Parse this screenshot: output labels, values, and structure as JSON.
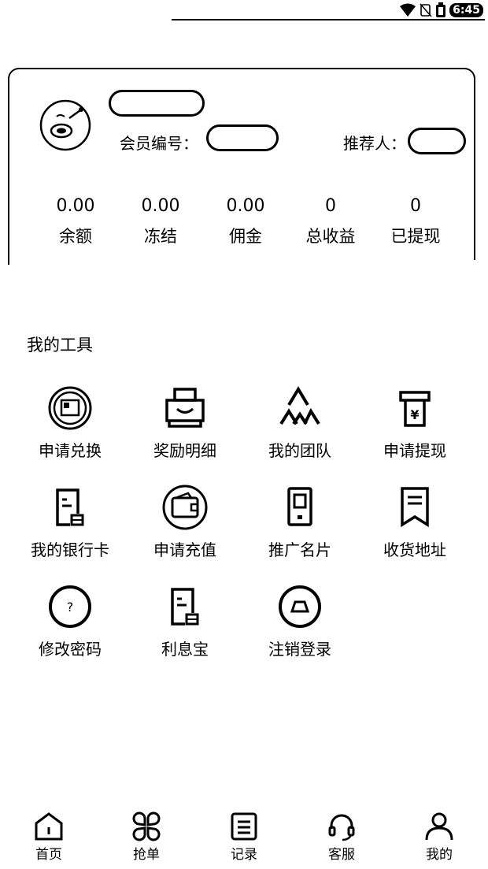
{
  "status_bar": {
    "time": "6:45"
  },
  "profile": {
    "member_no_label": "会员编号：",
    "referrer_label": "推荐人：",
    "stats": [
      {
        "value": "0.00",
        "label": "余额"
      },
      {
        "value": "0.00",
        "label": "冻结"
      },
      {
        "value": "0.00",
        "label": "佣金"
      },
      {
        "value": "0",
        "label": "总收益"
      },
      {
        "value": "0",
        "label": "已提现"
      }
    ]
  },
  "tools": {
    "title": "我的工具",
    "items": [
      {
        "label": "申请兑换",
        "icon": "exchange-icon"
      },
      {
        "label": "奖励明细",
        "icon": "printer-icon"
      },
      {
        "label": "我的团队",
        "icon": "team-icon"
      },
      {
        "label": "申请提现",
        "icon": "atm-icon"
      },
      {
        "label": "我的银行卡",
        "icon": "bank-doc-icon"
      },
      {
        "label": "申请充值",
        "icon": "wallet-icon"
      },
      {
        "label": "推广名片",
        "icon": "card-icon"
      },
      {
        "label": "收货地址",
        "icon": "bookmark-icon"
      },
      {
        "label": "修改密码",
        "icon": "question-icon"
      },
      {
        "label": "利息宝",
        "icon": "interest-doc-icon"
      },
      {
        "label": "注销登录",
        "icon": "logout-icon"
      }
    ]
  },
  "nav": {
    "items": [
      {
        "label": "首页",
        "icon": "home-icon"
      },
      {
        "label": "抢单",
        "icon": "grab-icon"
      },
      {
        "label": "记录",
        "icon": "records-icon"
      },
      {
        "label": "客服",
        "icon": "headset-icon"
      },
      {
        "label": "我的",
        "icon": "user-icon"
      }
    ]
  }
}
